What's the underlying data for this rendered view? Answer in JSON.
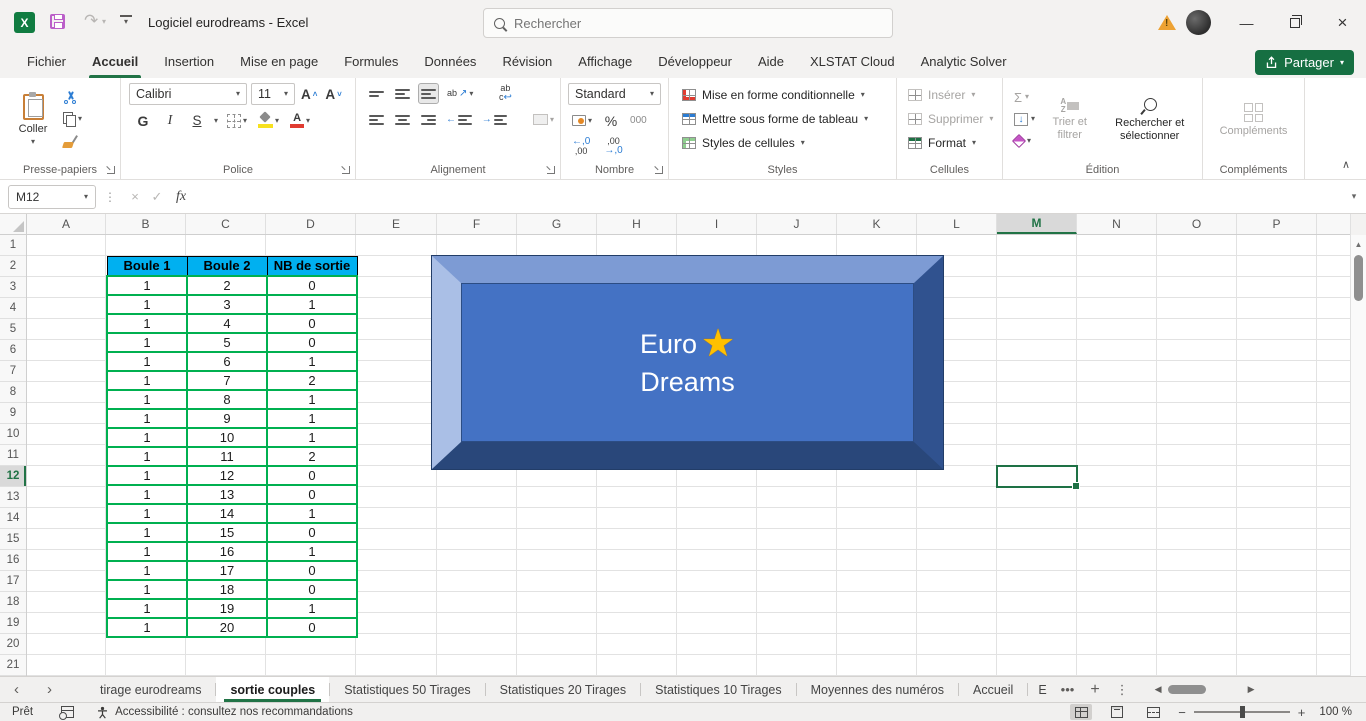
{
  "titlebar": {
    "title": "Logiciel eurodreams  -  Excel",
    "search_placeholder": "Rechercher"
  },
  "share_button": "Partager",
  "ribbon_tabs": [
    {
      "label": "Fichier",
      "active": false
    },
    {
      "label": "Accueil",
      "active": true
    },
    {
      "label": "Insertion",
      "active": false
    },
    {
      "label": "Mise en page",
      "active": false
    },
    {
      "label": "Formules",
      "active": false
    },
    {
      "label": "Données",
      "active": false
    },
    {
      "label": "Révision",
      "active": false
    },
    {
      "label": "Affichage",
      "active": false
    },
    {
      "label": "Développeur",
      "active": false
    },
    {
      "label": "Aide",
      "active": false
    },
    {
      "label": "XLSTAT Cloud",
      "active": false
    },
    {
      "label": "Analytic Solver",
      "active": false
    }
  ],
  "ribbon": {
    "clipboard": {
      "paste": "Coller",
      "group": "Presse-papiers"
    },
    "font": {
      "family": "Calibri",
      "size": "11",
      "bold": "G",
      "italic": "I",
      "underline": "S",
      "grow": "A",
      "shrink": "A",
      "color_letter": "A",
      "group": "Police"
    },
    "alignment": {
      "orient": "ab",
      "wrap_top": "ab",
      "wrap_bot": "c",
      "wrap_arrow": "↩",
      "orient_arrow": "↗",
      "indent_left": "←",
      "indent_right": "→",
      "group": "Alignement"
    },
    "number": {
      "format": "Standard",
      "percent": "%",
      "thousands": "000",
      "inc_top": "←,0",
      "inc_bot": ",00",
      "dec_top": ",00",
      "dec_bot": "→,0",
      "group": "Nombre"
    },
    "styles": {
      "items": [
        "Mise en forme conditionnelle",
        "Mettre sous forme de tableau",
        "Styles de cellules"
      ],
      "group": "Styles"
    },
    "cells": {
      "items": [
        "Insérer",
        "Supprimer",
        "Format"
      ],
      "group": "Cellules"
    },
    "editing": {
      "sigma": "Σ",
      "fill_arrow": "↓",
      "sort": "Trier et filtrer",
      "find": "Rechercher et sélectionner",
      "sort_a": "A",
      "sort_z": "Z",
      "group": "Édition"
    },
    "addins": {
      "button": "Compléments",
      "group": "Compléments"
    }
  },
  "formula_bar": {
    "name_box": "M12",
    "cancel": "×",
    "enter": "✓",
    "fx": "fx",
    "value": ""
  },
  "grid": {
    "column_headers": [
      "A",
      "B",
      "C",
      "D",
      "E",
      "F",
      "G",
      "H",
      "I",
      "J",
      "K",
      "L",
      "M",
      "N",
      "O",
      "P"
    ],
    "active_column": "M",
    "row_count": 21,
    "active_row": 12,
    "selected_cell": "M12"
  },
  "worksheet_table": {
    "headers": [
      "Boule 1",
      "Boule 2",
      "NB de sortie"
    ],
    "rows": [
      [
        "1",
        "2",
        "0"
      ],
      [
        "1",
        "3",
        "1"
      ],
      [
        "1",
        "4",
        "0"
      ],
      [
        "1",
        "5",
        "0"
      ],
      [
        "1",
        "6",
        "1"
      ],
      [
        "1",
        "7",
        "2"
      ],
      [
        "1",
        "8",
        "1"
      ],
      [
        "1",
        "9",
        "1"
      ],
      [
        "1",
        "10",
        "1"
      ],
      [
        "1",
        "11",
        "2"
      ],
      [
        "1",
        "12",
        "0"
      ],
      [
        "1",
        "13",
        "0"
      ],
      [
        "1",
        "14",
        "1"
      ],
      [
        "1",
        "15",
        "0"
      ],
      [
        "1",
        "16",
        "1"
      ],
      [
        "1",
        "17",
        "0"
      ],
      [
        "1",
        "18",
        "0"
      ],
      [
        "1",
        "19",
        "1"
      ],
      [
        "1",
        "20",
        "0"
      ]
    ]
  },
  "shape": {
    "line1": "Euro",
    "star": "★",
    "line2": "Dreams"
  },
  "sheet_tabs": {
    "tabs": [
      {
        "label": "tirage eurodreams",
        "active": false,
        "truncated": false
      },
      {
        "label": "sortie couples",
        "active": true,
        "truncated": false
      },
      {
        "label": "Statistiques 50 Tirages",
        "active": false,
        "truncated": false
      },
      {
        "label": "Statistiques 20 Tirages",
        "active": false,
        "truncated": false
      },
      {
        "label": "Statistiques 10 Tirages",
        "active": false,
        "truncated": false
      },
      {
        "label": "Moyennes des numéros",
        "active": false,
        "truncated": false
      },
      {
        "label": "Accueil",
        "active": false,
        "truncated": false
      },
      {
        "label": "E",
        "active": false,
        "truncated": true
      }
    ],
    "more": "•••",
    "add": "+",
    "menu": "⋮"
  },
  "status_bar": {
    "mode": "Prêt",
    "accessibility": "Accessibilité : consultez nos recommandations",
    "zoom": "100 %",
    "zoom_minus": "−",
    "zoom_plus": "+"
  },
  "glyphs": {
    "chevron_down": "▾",
    "collapse": "∧",
    "nav_left": "‹",
    "nav_right": "›",
    "scroll_up": "▲",
    "scroll_left": "◀",
    "scroll_right": "▶",
    "minimize": "—",
    "close": "×",
    "warning": "!",
    "redo": "↷",
    "dots": "⋮",
    "x_logo": "X"
  },
  "colors": {
    "accent_green": "#217346",
    "table_header_fill": "#00B0F0",
    "table_border": "#00B050",
    "shape_fill": "#4472C4",
    "star": "#FFC000",
    "share_green": "#166F42"
  }
}
